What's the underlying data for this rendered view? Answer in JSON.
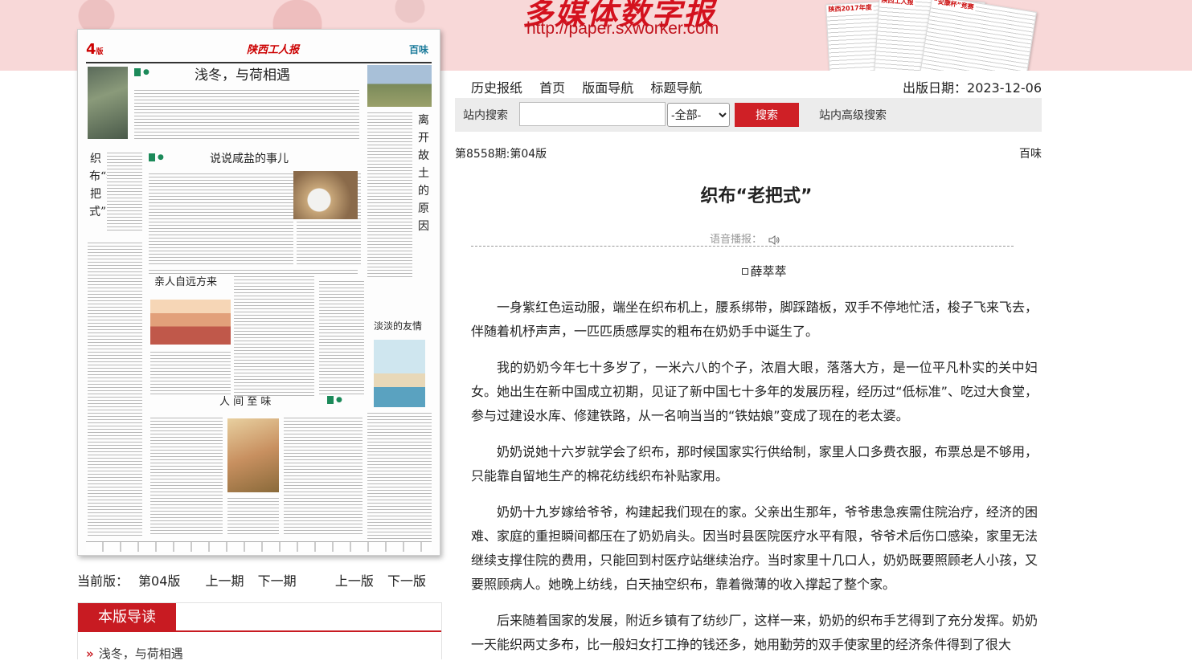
{
  "header": {
    "logo_text": "多媒体数字报",
    "url": "http://paper.sxworker.com",
    "paper_headlines": [
      "陕西2017年度",
      "陕西工人报",
      "“安康杯”竞赛"
    ]
  },
  "thumbnail": {
    "page_num": "4",
    "page_suffix": "版",
    "masthead": "陕西工人报",
    "section": "百味",
    "titles": {
      "t1": "浅冬，与荷相遇",
      "t2": "说说咸盐的事儿",
      "t3": "亲人自远方来",
      "t4": "淡淡的友情",
      "t5": "人 间 至 味",
      "v1": "离开故土的原因",
      "v2": "织布“老把式”"
    }
  },
  "pager": {
    "current_prefix": "当前版：",
    "current_page": "第04版",
    "prev_issue": "上一期",
    "next_issue": "下一期",
    "prev_page": "上一版",
    "next_page": "下一版"
  },
  "guide": {
    "title": "本版导读",
    "item": "浅冬，与荷相遇"
  },
  "nav": {
    "items": [
      "历史报纸",
      "首页",
      "版面导航",
      "标题导航"
    ],
    "pub_date_label": "出版日期：",
    "pub_date": "2023-12-06"
  },
  "search": {
    "label": "站内搜索",
    "value": "",
    "select_value": "-全部-",
    "button": "搜索",
    "advanced": "站内高级搜索"
  },
  "article": {
    "issue": "第8558期:第04版",
    "section": "百味",
    "title": "织布“老把式”",
    "voice_label": "语音播报：",
    "author": "薛萃萃",
    "paragraphs": [
      "一身紫红色运动服，端坐在织布机上，腰系绑带，脚踩踏板，双手不停地忙活，梭子飞来飞去，伴随着机杼声声，一匹匹质感厚实的粗布在奶奶手中诞生了。",
      "我的奶奶今年七十多岁了，一米六八的个子，浓眉大眼，落落大方，是一位平凡朴实的关中妇女。她出生在新中国成立初期，见证了新中国七十多年的发展历程，经历过“低标准”、吃过大食堂，参与过建设水库、修建铁路，从一名响当当的“铁姑娘”变成了现在的老太婆。",
      "奶奶说她十六岁就学会了织布，那时候国家实行供给制，家里人口多费衣服，布票总是不够用，只能靠自留地生产的棉花纺线织布补贴家用。",
      "奶奶十九岁嫁给爷爷，构建起我们现在的家。父亲出生那年，爷爷患急疾需住院治疗，经济的困难、家庭的重担瞬间都压在了奶奶肩头。因当时县医院医疗水平有限，爷爷术后伤口感染，家里无法继续支撑住院的费用，只能回到村医疗站继续治疗。当时家里十几口人，奶奶既要照顾老人小孩，又要照顾病人。她晚上纺线，白天抽空织布，靠着微薄的收入撑起了整个家。",
      "后来随着国家的发展，附近乡镇有了纺纱厂，这样一来，奶奶的织布手艺得到了充分发挥。奶奶一天能织两丈多布，比一般妇女打工挣的钱还多，她用勤劳的双手使家里的经济条件得到了很大"
    ]
  }
}
